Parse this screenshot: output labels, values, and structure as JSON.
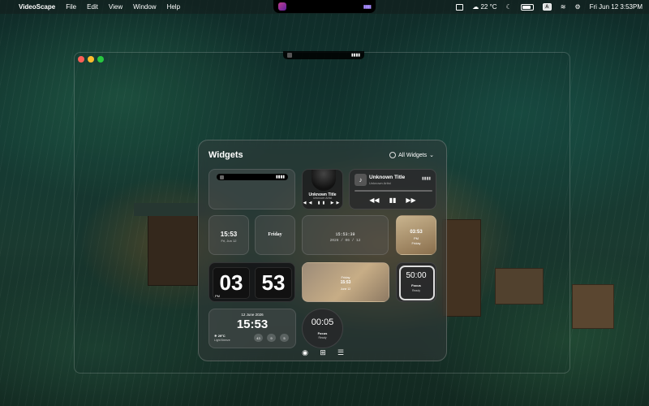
{
  "menubar": {
    "app_name": "VideoScape",
    "menus": [
      "File",
      "Edit",
      "View",
      "Window",
      "Help"
    ],
    "notch_bars": "▮▮▮▮",
    "weather": "22 °C",
    "date_time": "Fri Jun 12  3:53PM"
  },
  "mini_player": {
    "bars": "▮▮▮▮"
  },
  "panel": {
    "title": "Widgets",
    "filter_label": "All Widgets"
  },
  "widgets": {
    "island": {
      "bars": "▮▮▮▮"
    },
    "vinyl": {
      "title": "Unknown Title",
      "artist": "Unknown Artist",
      "controls": "◀◀ ▮▮ ▶▶"
    },
    "music": {
      "title": "Unknown Title",
      "artist": "Unknown Artist",
      "bars": "▮▮▮▮"
    },
    "time_small": {
      "time": "15:53",
      "date": "Fri, Jun 12"
    },
    "day": {
      "day": "Friday"
    },
    "digital": {
      "time": "15:53:39",
      "date": "2026 / 06 / 12"
    },
    "gold": {
      "time": "03:53",
      "ampm": "PM",
      "day": "Friday"
    },
    "flip": {
      "hours": "03",
      "minutes": "53",
      "ampm": "PM"
    },
    "gradient": {
      "day": "Friday",
      "time": "15:53",
      "date": "June 12"
    },
    "focus": {
      "value": "50:00",
      "label": "Focus",
      "status": "Ready"
    },
    "weather": {
      "date": "12 June 2026",
      "time": "15:53",
      "temp": "29°C",
      "condition": "Light Breeze",
      "pills": [
        "43",
        "9",
        "5"
      ]
    },
    "timer": {
      "value": "00:05",
      "label": "Focus",
      "status": "Ready"
    }
  },
  "colors": {
    "accent": "#a88cff",
    "red": "#ff5f57",
    "yellow": "#febc2e",
    "green": "#28c840"
  }
}
